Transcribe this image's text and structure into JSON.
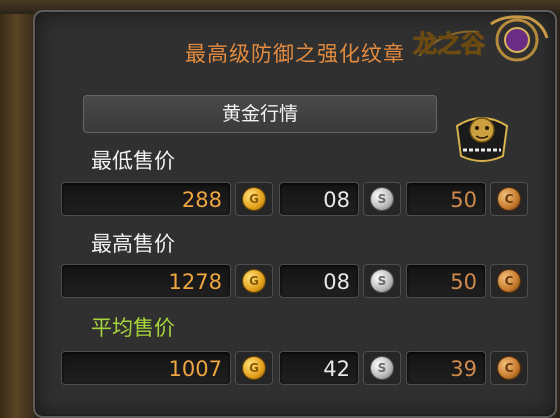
{
  "panel": {
    "title": "最高级防御之强化纹章",
    "subheader": "黄金行情",
    "logo_text": "龙之谷"
  },
  "rows": [
    {
      "label": "最低售价",
      "gold": "288",
      "silver": "08",
      "copper": "50"
    },
    {
      "label": "最高售价",
      "gold": "1278",
      "silver": "08",
      "copper": "50"
    },
    {
      "label": "平均售价",
      "gold": "1007",
      "silver": "42",
      "copper": "39"
    }
  ],
  "coins": {
    "gold": "gold-coin-icon",
    "silver": "silver-coin-icon",
    "copper": "copper-coin-icon"
  },
  "colors": {
    "title": "#e38b3f",
    "average_label": "#a6d53c",
    "gold_value": "#f0a640",
    "silver_value": "#e8e8e8",
    "copper_value": "#d08a4c"
  }
}
